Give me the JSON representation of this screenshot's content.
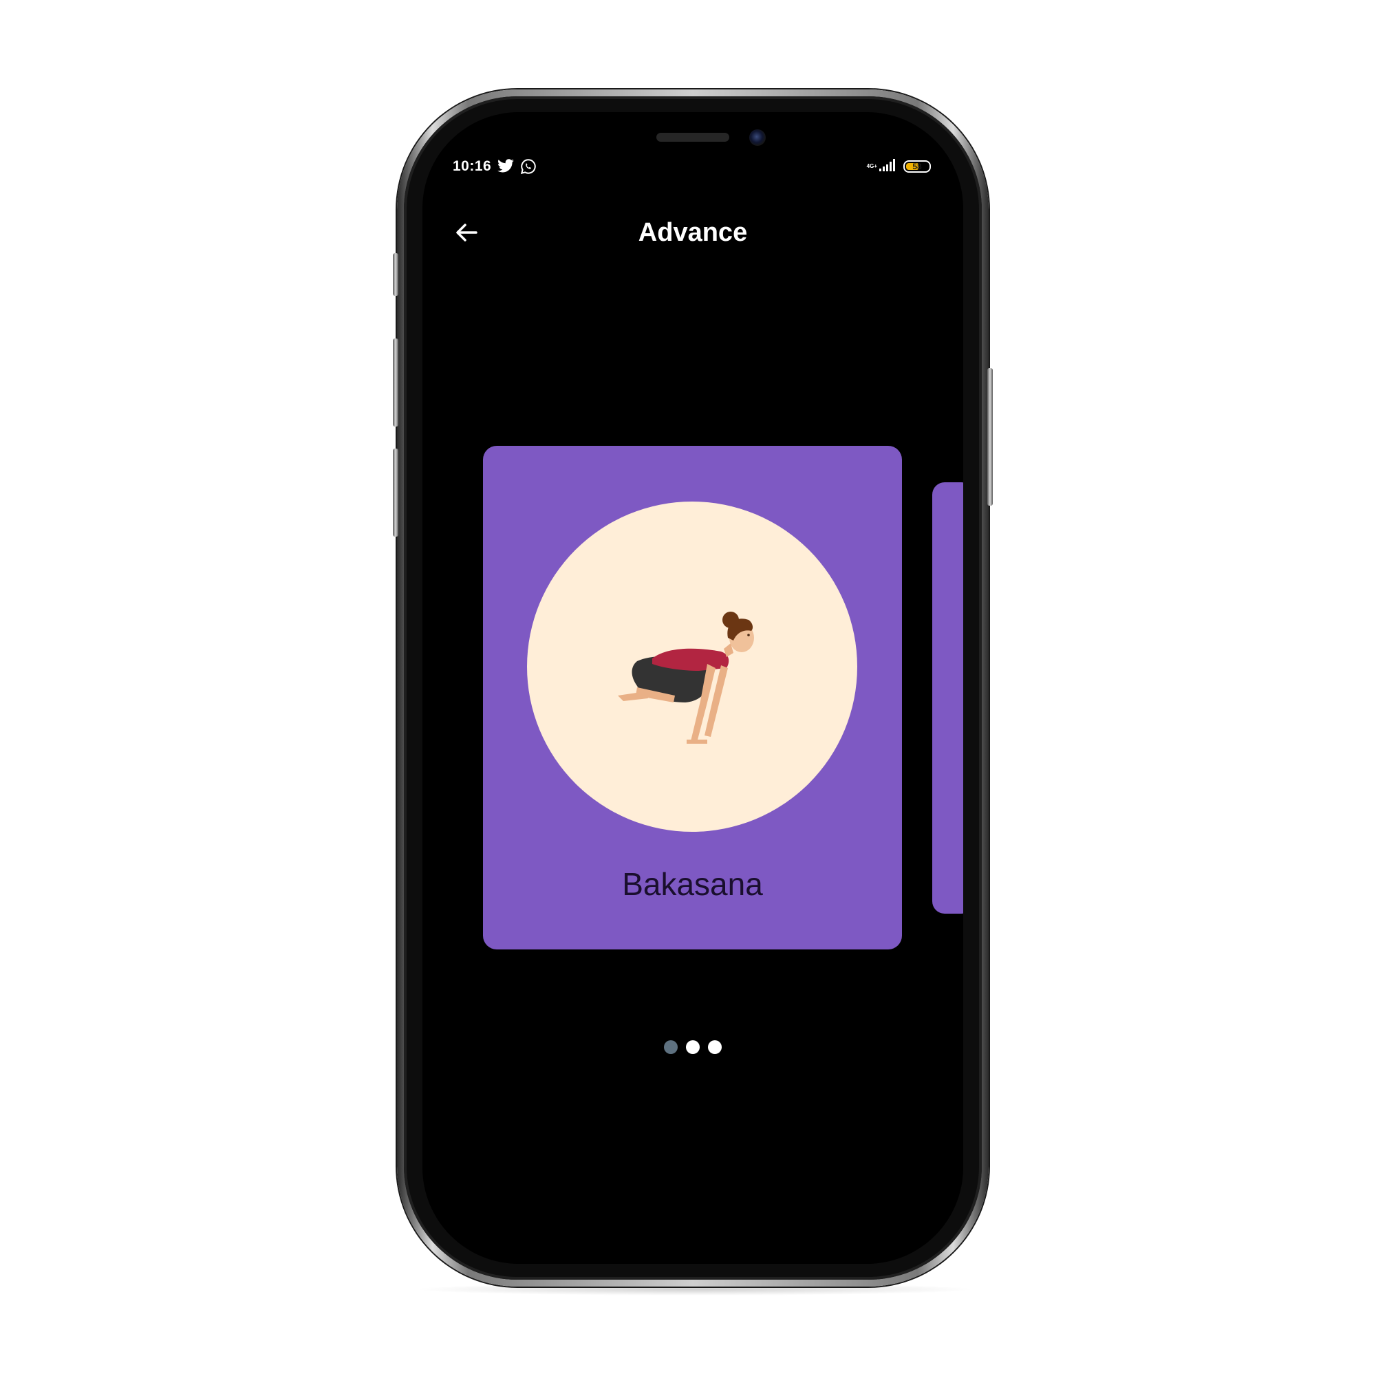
{
  "status_bar": {
    "time": "10:16",
    "network_label": "4G+",
    "battery_level": "58",
    "battery_fraction": 0.58,
    "notification_icons": [
      "twitter-icon",
      "whatsapp-icon"
    ]
  },
  "app_bar": {
    "title": "Advance",
    "back_icon": "arrow-left-icon"
  },
  "carousel": {
    "current_card": {
      "pose_name": "Bakasana",
      "illustration": "crow-pose-illustration"
    },
    "page_count": 3,
    "active_page": 1
  },
  "colors": {
    "background": "#000000",
    "card": "#7e59c3",
    "circle": "#ffeed8",
    "active_dot": "#5e7180",
    "inactive_dot": "#ffffff",
    "battery": "#f2b300"
  }
}
